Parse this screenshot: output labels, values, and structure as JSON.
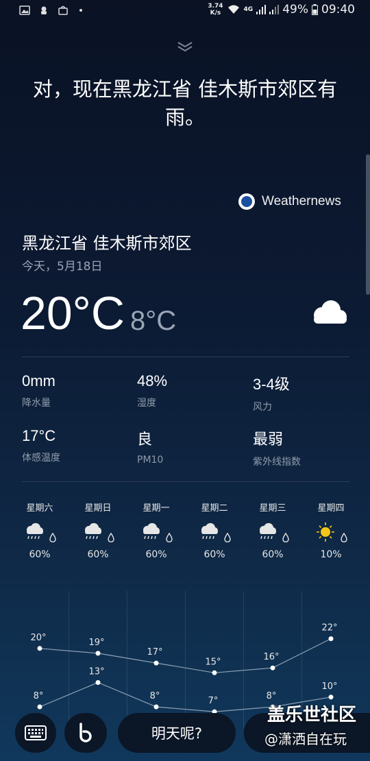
{
  "status_bar": {
    "speed_value": "3.74",
    "speed_unit": "K/s",
    "network": "4G",
    "battery": "49%",
    "time": "09:40"
  },
  "assistant": {
    "response": "对，现在黑龙江省 佳木斯市郊区有雨。"
  },
  "provider": {
    "name": "Weathernews"
  },
  "weather": {
    "location": "黑龙江省 佳木斯市郊区",
    "date": "今天，5月18日",
    "temp_high": "20°C",
    "temp_low": "8°C",
    "condition_icon": "cloud-icon"
  },
  "stats": [
    {
      "value": "0mm",
      "label": "降水量"
    },
    {
      "value": "48%",
      "label": "湿度"
    },
    {
      "value": "3-4级",
      "label": "风力"
    },
    {
      "value": "17°C",
      "label": "体感温度"
    },
    {
      "value": "良",
      "label": "PM10"
    },
    {
      "value": "最弱",
      "label": "紫外线指数"
    }
  ],
  "forecast": [
    {
      "day": "星期六",
      "icon": "rain-cloud-icon",
      "precip": "60%",
      "high": "20°",
      "low": "8°"
    },
    {
      "day": "星期日",
      "icon": "rain-cloud-icon",
      "precip": "60%",
      "high": "19°",
      "low": "13°"
    },
    {
      "day": "星期一",
      "icon": "rain-cloud-icon",
      "precip": "60%",
      "high": "17°",
      "low": "8°"
    },
    {
      "day": "星期二",
      "icon": "rain-cloud-icon",
      "precip": "60%",
      "high": "15°",
      "low": "7°"
    },
    {
      "day": "星期三",
      "icon": "rain-cloud-icon",
      "precip": "60%",
      "high": "16°",
      "low": "8°"
    },
    {
      "day": "星期四",
      "icon": "sun-icon",
      "precip": "10%",
      "high": "22°",
      "low": "10°"
    }
  ],
  "forecast_values": {
    "highs": [
      20,
      19,
      17,
      15,
      16,
      22
    ],
    "lows": [
      8,
      13,
      8,
      7,
      8,
      10
    ]
  },
  "bottom_bar": {
    "ask_label": "明天呢?"
  },
  "watermark": {
    "title": "盖乐世社区",
    "handle": "@潇洒自在玩"
  },
  "colors": {
    "accent_sun": "#f5c518",
    "graph_line": "#8ea2b8"
  }
}
